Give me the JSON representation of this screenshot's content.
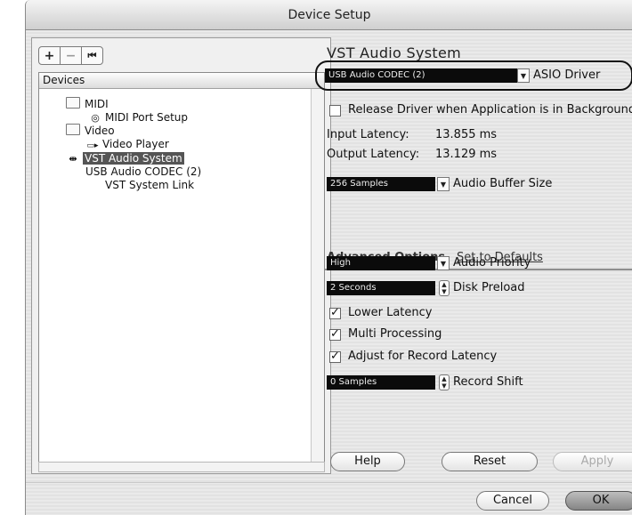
{
  "window": {
    "title": "Device Setup"
  },
  "toolbar": {
    "add": "+",
    "remove": "−",
    "reset": "⏮"
  },
  "devices": {
    "header": "Devices",
    "items": [
      {
        "label": "MIDI",
        "icon": "folder-icon"
      },
      {
        "label": "MIDI Port Setup",
        "icon": "midi-port-icon"
      },
      {
        "label": "Video",
        "icon": "folder-icon"
      },
      {
        "label": "Video Player",
        "icon": "video-player-icon"
      },
      {
        "label": "VST Audio System",
        "icon": "vst-audio-icon",
        "selected": true
      },
      {
        "label": "USB Audio CODEC  (2)"
      },
      {
        "label": "VST System Link"
      }
    ]
  },
  "vst": {
    "title": "VST Audio System",
    "driver_value": "USB Audio CODEC  (2)",
    "driver_label": "ASIO Driver",
    "release_label": "Release Driver when Application is in Background",
    "release_checked": false,
    "input_latency_label": "Input Latency:",
    "input_latency_value": "13.855 ms",
    "output_latency_label": "Output Latency:",
    "output_latency_value": "13.129 ms",
    "buffer_value": "256 Samples",
    "buffer_label": "Audio Buffer Size",
    "advanced_tab": "Advanced Options",
    "defaults_link": "Set to Defaults",
    "priority_value": "High",
    "priority_label": "Audio Priority",
    "preload_value": "2 Seconds",
    "preload_label": "Disk Preload",
    "lower_latency_label": "Lower Latency",
    "multi_processing_label": "Multi Processing",
    "adjust_record_label": "Adjust for Record Latency",
    "record_shift_value": "0 Samples",
    "record_shift_label": "Record Shift"
  },
  "buttons": {
    "help": "Help",
    "reset": "Reset",
    "apply": "Apply",
    "cancel": "Cancel",
    "ok": "OK"
  },
  "colors": {
    "selection": "#555555",
    "field": "#0b0b0b"
  }
}
